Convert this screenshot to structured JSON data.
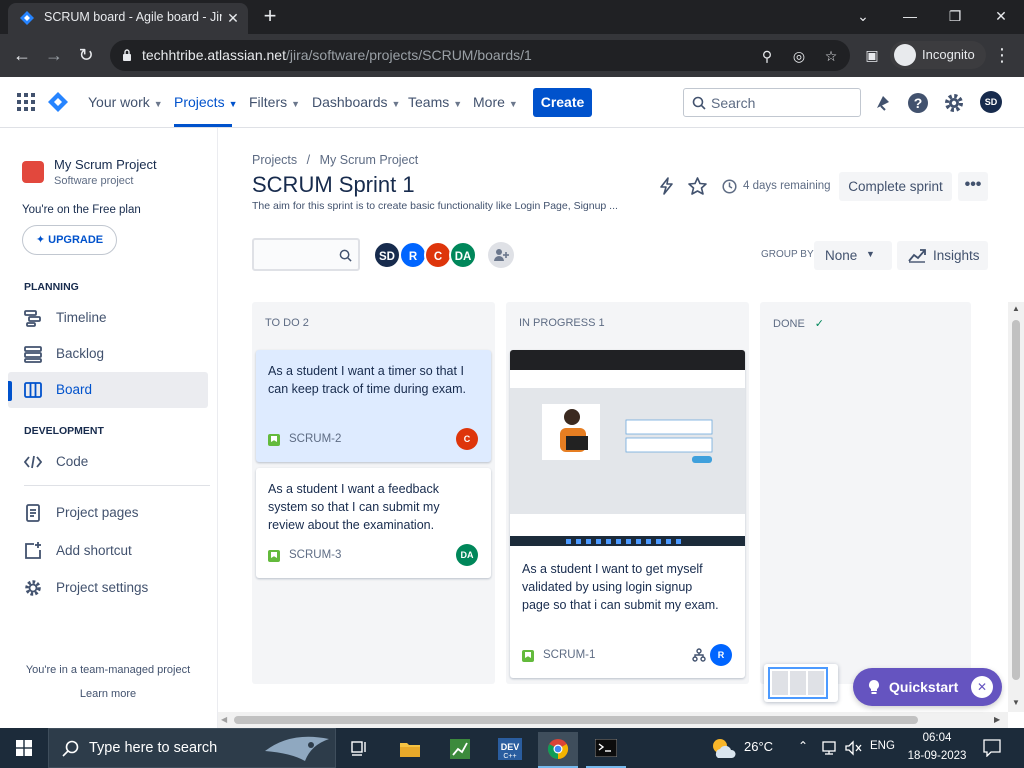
{
  "browser": {
    "tab_title": "SCRUM board - Agile board - Jira",
    "url_host": "techhtribe.atlassian.net",
    "url_path": "/jira/software/projects/SCRUM/boards/1",
    "incognito_label": "Incognito"
  },
  "topnav": {
    "your_work": "Your work",
    "projects": "Projects",
    "filters": "Filters",
    "dashboards": "Dashboards",
    "teams": "Teams",
    "more": "More",
    "create": "Create",
    "search_placeholder": "Search",
    "avatar_initials": "SD"
  },
  "sidebar": {
    "project_name": "My Scrum Project",
    "project_type": "Software project",
    "free_plan": "You're on the Free plan",
    "upgrade": "UPGRADE",
    "planning_header": "PLANNING",
    "development_header": "DEVELOPMENT",
    "items": [
      {
        "label": "Timeline"
      },
      {
        "label": "Backlog"
      },
      {
        "label": "Board"
      },
      {
        "label": "Code"
      },
      {
        "label": "Project pages"
      },
      {
        "label": "Add shortcut"
      },
      {
        "label": "Project settings"
      }
    ],
    "team_managed": "You're in a team-managed project",
    "learn_more": "Learn more"
  },
  "header": {
    "breadcrumb_projects": "Projects",
    "breadcrumb_sep": "/",
    "breadcrumb_project": "My Scrum Project",
    "title": "SCRUM Sprint 1",
    "goal": "The aim for this sprint is to create basic functionality like Login Page, Signup ...",
    "remaining": "4 days remaining",
    "complete_sprint": "Complete sprint"
  },
  "filters": {
    "avatars": [
      {
        "initials": "SD",
        "color": "#172b4d"
      },
      {
        "initials": "R",
        "color": "#0065ff"
      },
      {
        "initials": "C",
        "color": "#de350b"
      },
      {
        "initials": "DA",
        "color": "#00875a"
      }
    ],
    "group_by_label": "GROUP BY",
    "group_by_value": "None",
    "insights": "Insights"
  },
  "columns": [
    {
      "title": "TO DO 2",
      "cards": [
        {
          "summary": "As a student I want a timer so that I can keep track of time during exam.",
          "key": "SCRUM-2",
          "assignee": "C",
          "assignee_color": "#de350b"
        },
        {
          "summary": "As a student I want a feedback system so that I can submit my review about the examination.",
          "key": "SCRUM-3",
          "assignee": "DA",
          "assignee_color": "#00875a"
        }
      ]
    },
    {
      "title": "IN PROGRESS 1",
      "cards": [
        {
          "summary": "As a student I want to get myself validated by using login signup page so that i can submit my exam.",
          "key": "SCRUM-1",
          "assignee": "R",
          "assignee_color": "#0065ff"
        }
      ]
    },
    {
      "title": "DONE",
      "cards": []
    }
  ],
  "quickstart": "Quickstart",
  "taskbar": {
    "search_placeholder": "Type here to search",
    "temperature": "26°C",
    "language": "ENG",
    "time": "06:04",
    "date": "18-09-2023"
  }
}
